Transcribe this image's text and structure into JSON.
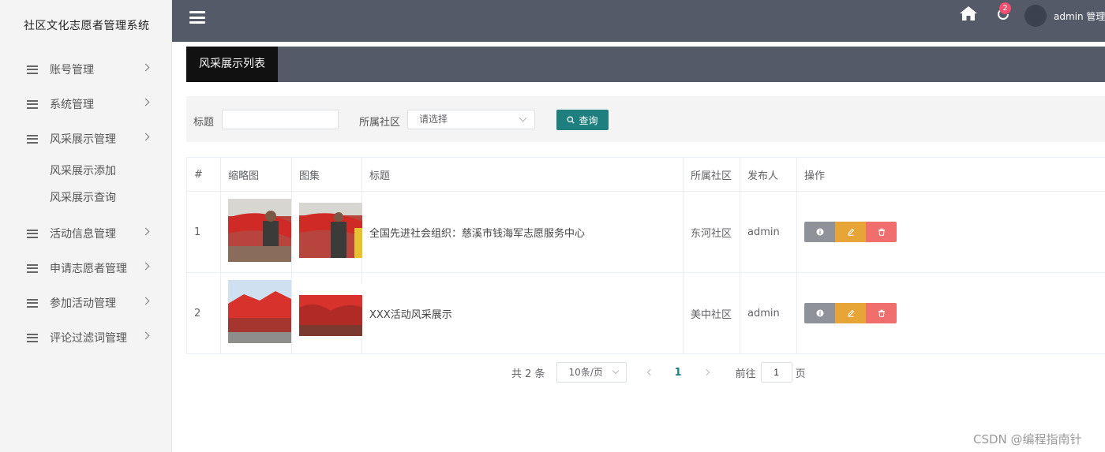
{
  "app": {
    "title": "社区文化志愿者管理系统"
  },
  "sidebar": {
    "items": [
      {
        "label": "账号管理"
      },
      {
        "label": "系统管理"
      },
      {
        "label": "风采展示管理",
        "children": [
          "风采展示添加",
          "风采展示查询"
        ]
      },
      {
        "label": "活动信息管理"
      },
      {
        "label": "申请志愿者管理"
      },
      {
        "label": "参加活动管理"
      },
      {
        "label": "评论过滤词管理"
      }
    ]
  },
  "header": {
    "home_icon": "home-icon",
    "notification_icon": "refresh-bell-icon",
    "notification_count": "2",
    "user_label": "admin 管理员"
  },
  "tabs": {
    "active_label": "风采展示列表"
  },
  "search": {
    "title_label": "标题",
    "title_value": "",
    "community_label": "所属社区",
    "community_placeholder": "请选择",
    "query_label": "查询"
  },
  "table": {
    "columns": [
      "#",
      "缩略图",
      "图集",
      "标题",
      "所属社区",
      "发布人",
      "操作"
    ],
    "rows": [
      {
        "index": "1",
        "title": "全国先进社会组织：慈溪市钱海军志愿服务中心",
        "community": "东河社区",
        "publisher": "admin"
      },
      {
        "index": "2",
        "title": "XXX活动风采展示",
        "community": "美中社区",
        "publisher": "admin"
      }
    ]
  },
  "pagination": {
    "total_text": "共 2 条",
    "page_size": "10条/页",
    "current_page": "1",
    "goto_label": "前往",
    "goto_value": "1",
    "page_suffix": "页"
  },
  "watermark": "CSDN @编程指南针",
  "colors": {
    "topbar": "#545a68",
    "accent": "#1f7f7f",
    "info": "#8f9399",
    "edit": "#e7a437",
    "delete": "#f06e6e",
    "badge": "#f0506e"
  }
}
